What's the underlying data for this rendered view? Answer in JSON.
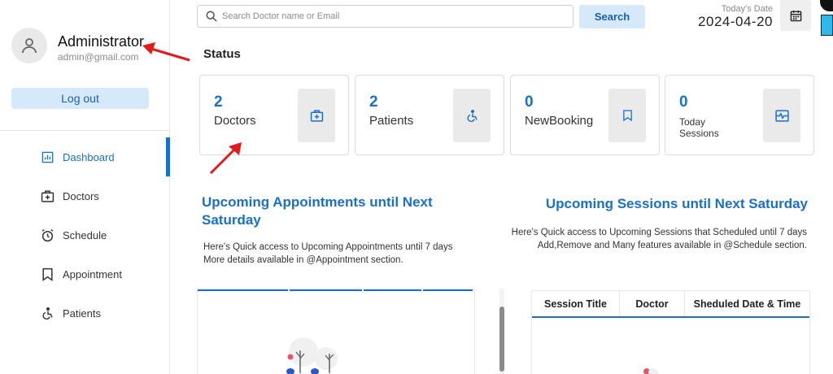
{
  "sidebar": {
    "admin_name": "Administrator",
    "admin_email": "admin@gmail.com",
    "logout_label": "Log out",
    "items": [
      {
        "label": "Dashboard",
        "icon": "dashboard-icon",
        "active": true
      },
      {
        "label": "Doctors",
        "icon": "doctors-icon"
      },
      {
        "label": "Schedule",
        "icon": "schedule-icon"
      },
      {
        "label": "Appointment",
        "icon": "appointment-icon"
      },
      {
        "label": "Patients",
        "icon": "patients-icon"
      }
    ]
  },
  "search": {
    "placeholder": "Search Doctor name or Email",
    "button_label": "Search"
  },
  "date": {
    "label": "Today's Date",
    "value": "2024-04-20"
  },
  "status": {
    "title": "Status",
    "cards": [
      {
        "count": "2",
        "label": "Doctors",
        "icon": "doctors-icon"
      },
      {
        "count": "2",
        "label": "Patients",
        "icon": "patients-icon"
      },
      {
        "count": "0",
        "label": "NewBooking",
        "icon": "bookmark-icon"
      },
      {
        "count": "0",
        "label": "Today Sessions",
        "icon": "sessions-icon"
      }
    ]
  },
  "appointments": {
    "title": "Upcoming Appointments until Next Saturday",
    "desc_line1": "Here's Quick access to Upcoming Appointments until 7 days",
    "desc_line2": "More details available in @Appointment section."
  },
  "sessions": {
    "title": "Upcoming Sessions until Next Saturday",
    "desc_line1": "Here's Quick access to Upcoming Sessions that Scheduled until 7 days",
    "desc_line2": "Add,Remove and Many features available in @Schedule section.",
    "columns": [
      "Session Title",
      "Doctor",
      "Sheduled Date & Time"
    ]
  },
  "colors": {
    "accent": "#1a6fc9",
    "button_bg": "#d6e9fb",
    "annotation_arrow": "#e01b1b"
  }
}
